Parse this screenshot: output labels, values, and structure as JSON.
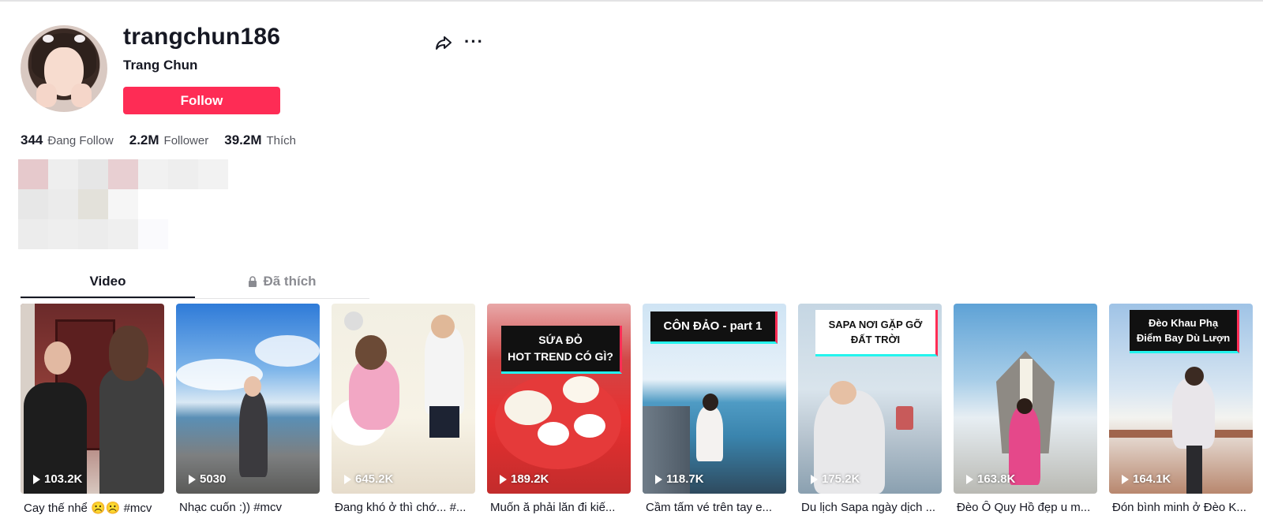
{
  "profile": {
    "username": "trangchun186",
    "nickname": "Trang Chun",
    "follow_label": "Follow",
    "stats": [
      {
        "count": "344",
        "label": "Đang Follow"
      },
      {
        "count": "2.2M",
        "label": "Follower"
      },
      {
        "count": "39.2M",
        "label": "Thích"
      }
    ]
  },
  "tabs": [
    {
      "label": "Video"
    },
    {
      "label": "Đã thích"
    }
  ],
  "videos": [
    {
      "views": "103.2K",
      "caption": "Cay thế nhể ☹️☹️ #mcv",
      "overlay": ""
    },
    {
      "views": "5030",
      "caption": "Nhạc cuốn :)) #mcv",
      "overlay": ""
    },
    {
      "views": "645.2K",
      "caption": "Đang khó ở thì chớ... #...",
      "overlay": ""
    },
    {
      "views": "189.2K",
      "caption": "Muốn ă phải lăn đi kiế...",
      "overlay": "SỨA ĐỎ\nHOT TREND CÓ GÌ?"
    },
    {
      "views": "118.7K",
      "caption": "Cầm tấm vé trên tay e...",
      "overlay": "CÔN ĐẢO - part 1"
    },
    {
      "views": "175.2K",
      "caption": "Du lịch Sapa ngày dịch ...",
      "overlay": "SAPA NƠI GẶP GỠ\nĐẤT TRỜI"
    },
    {
      "views": "163.8K",
      "caption": "Đèo Ô Quy Hồ đẹp u m...",
      "overlay": ""
    },
    {
      "views": "164.1K",
      "caption": "Đón bình minh ở Đèo K...",
      "overlay": "Đèo Khau Phạ\nĐiểm Bay Dù Lượn"
    }
  ],
  "colors": {
    "accent": "#fe2c55",
    "text": "#161823"
  },
  "icons": {
    "share": "share-icon",
    "more": "more-icon",
    "lock": "lock-icon",
    "play": "play-icon"
  }
}
